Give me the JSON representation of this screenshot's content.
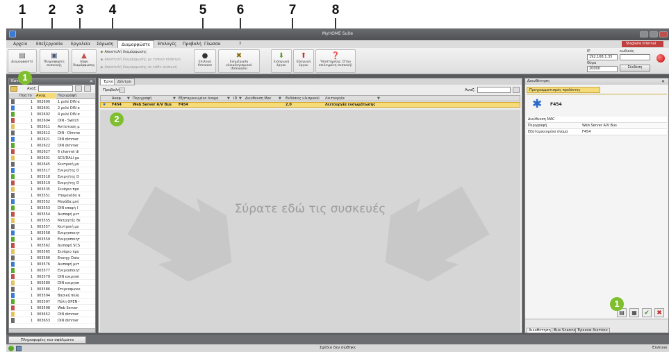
{
  "callouts": [
    "1",
    "2",
    "3",
    "4",
    "5",
    "6",
    "7",
    "8"
  ],
  "badges": {
    "left_panel": "1",
    "center_row": "2",
    "bottom_right": "1"
  },
  "window": {
    "title": "MyHOME Suite",
    "user_badge": "Stagiaire Internal"
  },
  "menu": [
    "Αρχείο",
    "Επεξεργασία",
    "Εργαλεία",
    "Σάρωση",
    "Διαμορφώστε",
    "Επιλογές",
    "Προβολή",
    "Γλώσσα",
    "?"
  ],
  "menu_active": "Διαμορφώστε",
  "ribbon": {
    "configure": "Διαμορφώστε",
    "device_info": "Πληροφορίες συσκευής",
    "receive_config": "Λήψη διαμόρφωσης",
    "send_configuration": "Αποστολή διαμόρφωσης",
    "send_local_button": "Αποστολή διαμόρφωσης με τοπικό πλήκτρο",
    "send_each_device": "Αποστολή διαμόρφωσης σε κάθε συσκευή",
    "firmware_select": "Επιλογή firmware",
    "firmware_update": "Ενημέρωση υλικολογισμικού (firmware)",
    "import_project": "Εισαγωγή έργου",
    "export_project": "Εξαγωγή έργου",
    "support": "Υποστήριξης (Στην επιλεγμένη συσκευή)",
    "ip_label": "IP",
    "ip_value": "192.168.1.35",
    "port_label": "Θύρα",
    "port_value": "20000",
    "code_label": "κωδικός",
    "connect": "Σύνδεση"
  },
  "catalog": {
    "title": "Κατάλογος",
    "search_label": "Αναζ.",
    "columns": [
      "Ποσ.το",
      "Αναφ.",
      "Περιγραφή"
    ],
    "rows": [
      {
        "qty": "1",
        "ref": "002600",
        "desc": "1 ρελέ DIN α"
      },
      {
        "qty": "1",
        "ref": "002601",
        "desc": "2 ρελέ DIN α"
      },
      {
        "qty": "1",
        "ref": "002602",
        "desc": "4 ρελέ DIN α"
      },
      {
        "qty": "1",
        "ref": "002604",
        "desc": "DIN - Switch"
      },
      {
        "qty": "1",
        "ref": "002611",
        "desc": "Αντίσταση μ"
      },
      {
        "qty": "1",
        "ref": "002612",
        "desc": "DIN - Dimme"
      },
      {
        "qty": "1",
        "ref": "002621",
        "desc": "DIN dimmer"
      },
      {
        "qty": "1",
        "ref": "002622",
        "desc": "DIN dimmer"
      },
      {
        "qty": "1",
        "ref": "002627",
        "desc": "6 channel di"
      },
      {
        "qty": "1",
        "ref": "002631",
        "desc": "SCS/DALI ga"
      },
      {
        "qty": "1",
        "ref": "002645",
        "desc": "Κεντρική μο"
      },
      {
        "qty": "1",
        "ref": "003517",
        "desc": "Ενεργ/της D"
      },
      {
        "qty": "1",
        "ref": "003518",
        "desc": "Ενεργ/της D"
      },
      {
        "qty": "1",
        "ref": "003519",
        "desc": "Ενεργ/της D"
      },
      {
        "qty": "1",
        "ref": "003535",
        "desc": "Σενάριο προ"
      },
      {
        "qty": "1",
        "ref": "003551",
        "desc": "Υπομονάδα α"
      },
      {
        "qty": "1",
        "ref": "003552",
        "desc": "Μονάδα μνή"
      },
      {
        "qty": "1",
        "ref": "003553",
        "desc": "DIN εποφή Ι"
      },
      {
        "qty": "1",
        "ref": "003554",
        "desc": "Διεπαφή μετ"
      },
      {
        "qty": "1",
        "ref": "003555",
        "desc": "Μετρητής θε"
      },
      {
        "qty": "1",
        "ref": "003557",
        "desc": "Κεντρική μο"
      },
      {
        "qty": "1",
        "ref": "003558",
        "desc": "Ενεργοποιητ"
      },
      {
        "qty": "1",
        "ref": "003559",
        "desc": "Ενεργοποιητ"
      },
      {
        "qty": "1",
        "ref": "003562",
        "desc": "Διεπαφή SCS"
      },
      {
        "qty": "1",
        "ref": "003565",
        "desc": "Σενάριο προ"
      },
      {
        "qty": "1",
        "ref": "003566",
        "desc": "Energy Data"
      },
      {
        "qty": "1",
        "ref": "003576",
        "desc": "Διεπαφή μετ"
      },
      {
        "qty": "1",
        "ref": "003577",
        "desc": "Ενεργοποιητ"
      },
      {
        "qty": "1",
        "ref": "003579",
        "desc": "DIN ενεργοπ"
      },
      {
        "qty": "1",
        "ref": "003580",
        "desc": "DIN ενεργοπ"
      },
      {
        "qty": "1",
        "ref": "003586",
        "desc": "Στερεοφωνικ"
      },
      {
        "qty": "1",
        "ref": "003594",
        "desc": "Βασική πύλη"
      },
      {
        "qty": "1",
        "ref": "003597",
        "desc": "Πύλη OPEN -"
      },
      {
        "qty": "1",
        "ref": "003598",
        "desc": "Web Server"
      },
      {
        "qty": "1",
        "ref": "003652",
        "desc": "DIN dimmer"
      },
      {
        "qty": "1",
        "ref": "003653",
        "desc": "DIN dimmer"
      }
    ]
  },
  "project": {
    "tabs": [
      "Έργο",
      "Δέντρο"
    ],
    "view_label": "Προβολή",
    "search_label": "Αναζ.",
    "columns": [
      "Αναφ.",
      "Περιγραφή",
      "Εξατομικευμένο όνομα",
      "ID",
      "Διεύθυνση Mac",
      "Εκδόσεις υλισμικού",
      "Λειτουργία"
    ],
    "row": {
      "ref": "F454",
      "desc": "Web Server A/V Bus",
      "name": "F454",
      "id": "",
      "mac": "",
      "fw": "2.0",
      "mode": "Λειτουργία ενσωμάτωσης"
    },
    "drop_hint": "Σύρατε εδώ τις συσκευές"
  },
  "properties": {
    "title": "Διευθέτηση",
    "header": "Προγραμματισμός προϊόντος",
    "device_name": "F454",
    "fields": [
      {
        "label": "Διεύθυνση MAC",
        "value": ""
      },
      {
        "label": "Περιγραφή",
        "value": "Web Server A/V Bus"
      },
      {
        "label": "Εξατομικευμένο όνομα",
        "value": "F454"
      }
    ],
    "tabs": [
      "Διευθέτηση",
      "Bus Scanner",
      "Έρευνα δικτύου"
    ]
  },
  "bottom": {
    "info_button": "Πληροφορίες και σφάλματα"
  },
  "status": {
    "center": "Σχέδιο δεν σώθηκε",
    "right": "Ελληνικ"
  },
  "colors": {
    "accent_green": "#7fbf2f",
    "selection_yellow": "#f6dc78",
    "dark_chrome": "#58595b"
  }
}
